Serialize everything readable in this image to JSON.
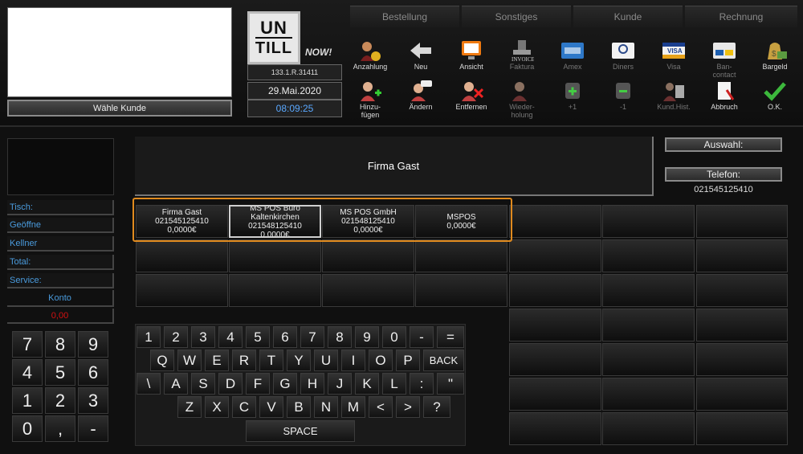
{
  "customer": {
    "choose_label": "Wähle Kunde"
  },
  "logo": {
    "line1": "UN",
    "line2": "TILL",
    "now": "NOW!"
  },
  "info": {
    "version": "133.1.R.31411",
    "date": "29.Mai.2020",
    "time": "08:09:25"
  },
  "tabs": [
    "Bestellung",
    "Sonstiges",
    "Kunde",
    "Rechnung"
  ],
  "toolbar_row1": [
    {
      "label": "Anzahlung",
      "icon": "person-coins-icon"
    },
    {
      "label": "Neu",
      "icon": "arrow-left-icon"
    },
    {
      "label": "Ansicht",
      "icon": "monitor-icon"
    },
    {
      "label": "Faktura",
      "icon": "invoice-stamp-icon"
    },
    {
      "label": "Amex",
      "icon": "amex-card-icon"
    },
    {
      "label": "Diners",
      "icon": "diners-card-icon"
    },
    {
      "label": "Visa",
      "icon": "visa-card-icon"
    },
    {
      "label": "Ban-\ncontact",
      "icon": "bancontact-card-icon"
    },
    {
      "label": "Bargeld",
      "icon": "cash-bag-icon"
    }
  ],
  "toolbar_row2": [
    {
      "label": "Hinzu-\nfügen",
      "icon": "person-add-icon"
    },
    {
      "label": "Ändern",
      "icon": "person-edit-icon"
    },
    {
      "label": "Entfernen",
      "icon": "person-remove-icon"
    },
    {
      "label": "Wieder-\nholung",
      "icon": "person-repeat-icon"
    },
    {
      "label": "+1",
      "icon": "plus-one-icon"
    },
    {
      "label": "-1",
      "icon": "minus-one-icon"
    },
    {
      "label": "Kund.Hist.",
      "icon": "customer-history-icon"
    },
    {
      "label": "Abbruch",
      "icon": "cancel-document-icon"
    },
    {
      "label": "O.K.",
      "icon": "checkmark-icon"
    }
  ],
  "side": {
    "fields": [
      "Tisch:",
      "Geöffne",
      "Kellner",
      "Total:",
      "Service:"
    ],
    "konto_label": "Konto",
    "konto_value": "0,00"
  },
  "numpad": [
    "7",
    "8",
    "9",
    "4",
    "5",
    "6",
    "1",
    "2",
    "3",
    "0",
    ",",
    "-"
  ],
  "panel": {
    "title": "Firma Gast",
    "auswahl": "Auswahl:",
    "telefon": "Telefon:",
    "telefon_value": "021545125410"
  },
  "customers": [
    {
      "lines": [
        "Firma Gast",
        "021545125410",
        "0,0000€"
      ]
    },
    {
      "lines": [
        "MS POS Büro",
        "Kaltenkirchen",
        "021548125410",
        "0,0000€"
      ]
    },
    {
      "lines": [
        "MS POS GmbH",
        "021548125410",
        "0,0000€"
      ]
    },
    {
      "lines": [
        "MSPOS",
        "0,0000€"
      ]
    }
  ],
  "keyboard": {
    "row1": [
      "1",
      "2",
      "3",
      "4",
      "5",
      "6",
      "7",
      "8",
      "9",
      "0",
      "-",
      "="
    ],
    "row2": [
      "Q",
      "W",
      "E",
      "R",
      "T",
      "Y",
      "U",
      "I",
      "O",
      "P",
      "BACK"
    ],
    "row3": [
      "\\",
      "A",
      "S",
      "D",
      "F",
      "G",
      "H",
      "J",
      "K",
      "L",
      ":",
      "\""
    ],
    "row4": [
      "Z",
      "X",
      "C",
      "V",
      "B",
      "N",
      "M",
      "<",
      ">",
      "?"
    ],
    "space": "SPACE"
  },
  "colors": {
    "accent_time": "#5aa8ff",
    "field_label": "#4a9bdd",
    "saldo": "#d41010",
    "highlight": "#e08a1e"
  }
}
